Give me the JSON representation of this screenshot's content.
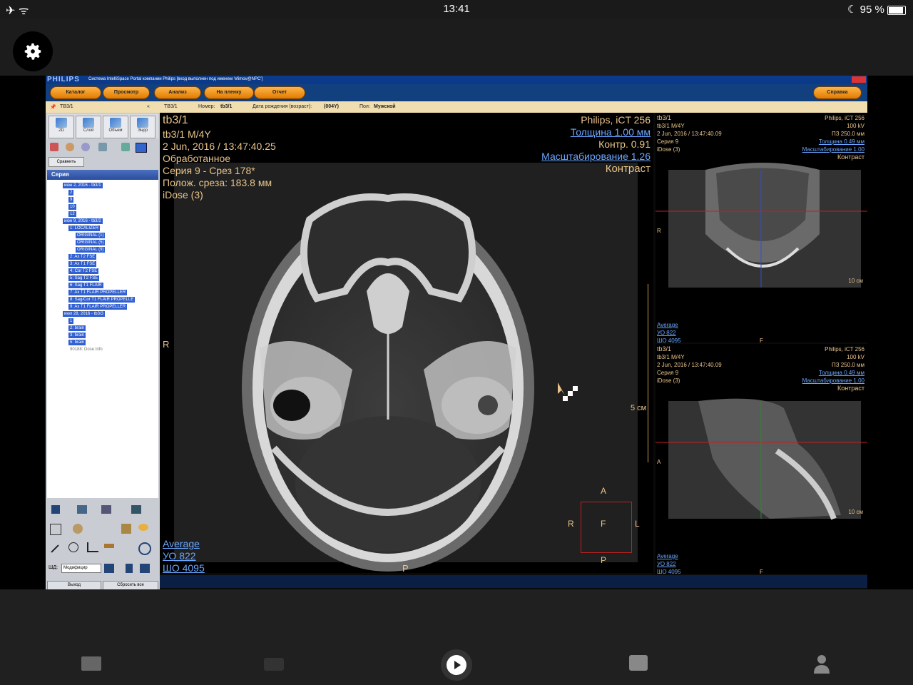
{
  "status": {
    "time": "13:41",
    "battery": "95 %"
  },
  "app": {
    "brand": "PHILIPS",
    "title": "Система IntelliSpace Portal компании Philips [вход выполнен под именем 'efimov@NPC']",
    "nav": [
      "Каталог",
      "Просмотр",
      "Анализ",
      "На пленку",
      "Отчет"
    ],
    "help": "Справка",
    "info": {
      "patient": "ТВ3/1",
      "tab": "ТВ3/1",
      "number_label": "Номер:",
      "number": "tb3/1",
      "dob_label": "Дата рождения (возраст):",
      "dob": "(004Y)",
      "sex_label": "Пол:",
      "sex": "Мужской"
    }
  },
  "tools": [
    "2D",
    "Слой",
    "Объем",
    "Эндо"
  ],
  "compare_label": "Сравнить",
  "series": {
    "title": "Серия",
    "items": [
      "июн 2, 2016 - tb3/1",
      "2",
      "9",
      "10",
      "12",
      "июн 9, 2016 - tb3/2",
      "1: LOCALIZER",
      "ORIGINAL (1)",
      "ORIGINAL (5)",
      "ORIGINAL (9)",
      "2: Ax T2 FSE",
      "3: Ax T1 FSE",
      "4: Cor T2 FSE",
      "5: Sag T2 FSE",
      "6: Sag T1 FLAIR",
      "7: Ax T1 FLAIR PROPELLER",
      "8: Sag/Cor T1 FLAIR PROPELLE",
      "9: Ax T1 FLAIR PROPELLER",
      "июл 28, 2016 - tb3/3",
      "1",
      "2: brain",
      "3: brain",
      "5: brain",
      "90188: Dose Info"
    ]
  },
  "bottom": {
    "wl_label": "ШД:",
    "wl_value": "Модифицир",
    "exit": "Выход",
    "reset": "Сбросить все"
  },
  "main_view": {
    "left": [
      "tb3/1",
      "tb3/1 M/4Y",
      "2 Jun, 2016 / 13:47:40.25",
      "Обработанное",
      "Серия 9 - Срез 178*",
      "Полож. среза: 183.8 мм",
      "iDose (3)"
    ],
    "right_plain1": "Philips, iCT 256",
    "thickness": "Толщина 1.00 мм",
    "contrast_val": "Контр. 0.91",
    "scale": "Масштабирование 1.26",
    "contrast": "Контраст",
    "scale_bar": "5 см",
    "orient_r": "R",
    "orient_p": "P",
    "wl_avg": "Average",
    "wl_yo": "УО   822",
    "wl_sho": "ШО  4095",
    "cube": {
      "a": "A",
      "r": "R",
      "f": "F",
      "l": "L",
      "p": "P"
    }
  },
  "cor_view": {
    "left": [
      "tb3/1",
      "tb3/1 M/4Y",
      "2 Jun, 2016 / 13:47:40.09",
      "Серия 9",
      "iDose (3)"
    ],
    "right": [
      "Philips, iCT 256",
      "100 kV",
      "ПЗ 250.0 мм"
    ],
    "thickness": "Толщина 0.49 мм",
    "scale": "Масштабирование 1.00",
    "contrast": "Контраст",
    "scale_bar": "10 см",
    "orient": "R",
    "bottom": "F",
    "wl_avg": "Average",
    "wl_yo": "УО   822",
    "wl_sho": "ШО  4095"
  },
  "sag_view": {
    "left": [
      "tb3/1",
      "tb3/1 M/4Y",
      "2 Jun, 2016 / 13:47:40.09",
      "Серия 9",
      "iDose (3)"
    ],
    "right": [
      "Philips, iCT 256",
      "100 kV",
      "ПЗ 250.0 мм"
    ],
    "thickness": "Толщина 0.49 мм",
    "scale": "Масштабирование 1.00",
    "contrast": "Контраст",
    "scale_bar": "10 см",
    "orient": "A",
    "bottom": "F",
    "wl_avg": "Average",
    "wl_yo": "УО   822",
    "wl_sho": "ШО  4095"
  }
}
